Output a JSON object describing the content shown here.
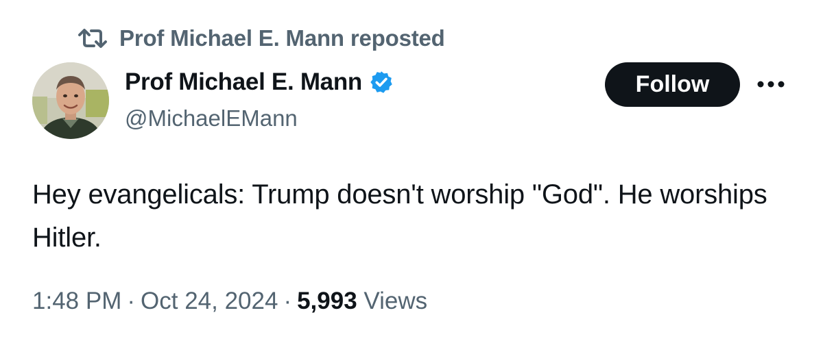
{
  "repost": {
    "icon": "repost-icon",
    "text": "Prof Michael E. Mann reposted"
  },
  "author": {
    "display_name": "Prof Michael E. Mann",
    "handle": "@MichaelEMann",
    "verified": true,
    "verified_color": "#1d9bf0",
    "avatar_icon": "avatar"
  },
  "actions": {
    "follow_label": "Follow",
    "more_icon": "more-options-icon"
  },
  "tweet": {
    "text": "Hey evangelicals: Trump doesn't worship \"God\". He worships Hitler."
  },
  "meta": {
    "time": "1:48 PM",
    "separator": "·",
    "date": "Oct 24, 2024",
    "views_count": "5,993",
    "views_label": "Views"
  },
  "colors": {
    "text_primary": "#0f1419",
    "text_secondary": "#536471",
    "button_bg": "#0f1419",
    "accent": "#1d9bf0"
  }
}
